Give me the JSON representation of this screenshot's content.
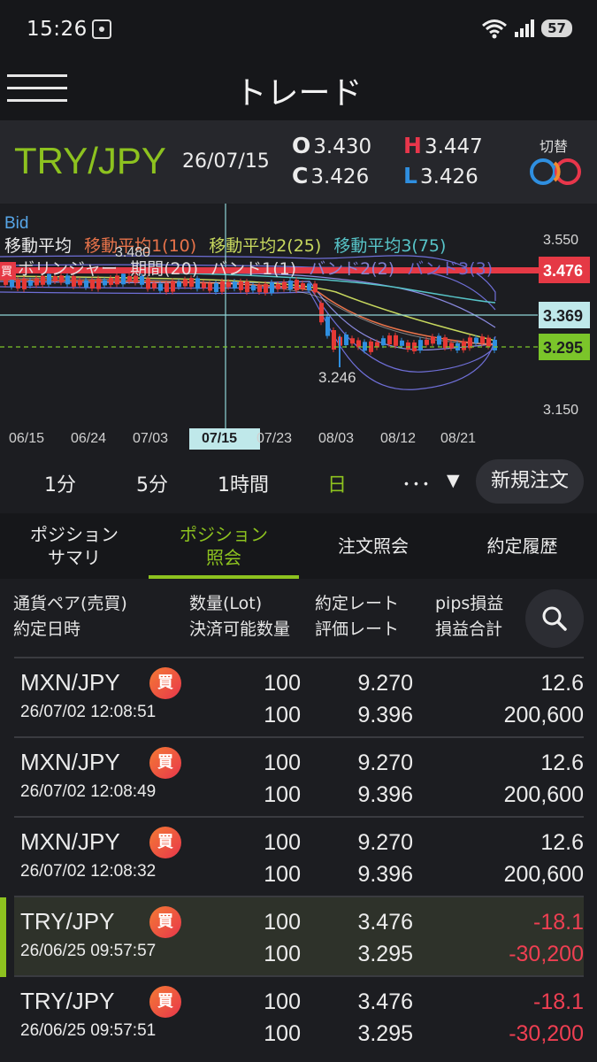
{
  "status": {
    "time": "15:26",
    "battery": "57",
    "wifi_badge": "6"
  },
  "header": {
    "title": "トレード",
    "menu_icon": "hamburger-icon"
  },
  "quote": {
    "pair": "TRY/JPY",
    "date": "26/07/15",
    "open_label": "O",
    "open": "3.430",
    "close_label": "C",
    "close": "3.426",
    "high_label": "H",
    "high": "3.447",
    "low_label": "L",
    "low": "3.426",
    "switch_label": "切替"
  },
  "chart": {
    "price_type": "Bid",
    "legend_line1": [
      "移動平均",
      "移動平均1(10)",
      "移動平均2(25)",
      "移動平均3(75)"
    ],
    "legend_line2": [
      "ボリンジャー",
      "期間(20)",
      "バンド1(1)",
      "バンド2(2)",
      "バンド3(3)"
    ],
    "buy_tag": "買",
    "axis_top": "3.550",
    "axis_bottom": "3.150",
    "order_rate": "3.476",
    "crosshair_rate": "3.369",
    "current_rate": "3.295",
    "peak_label": "3.480",
    "low_label": "3.246",
    "x_ticks": [
      "06/15",
      "06/24",
      "07/03",
      "07/15",
      "07/23",
      "08/03",
      "08/12",
      "08/21"
    ],
    "selected_date": "07/15",
    "colors": {
      "up": "#e53935",
      "down": "#2f8fe0",
      "ma1": "#e8734a",
      "ma2": "#c7d85e",
      "ma3": "#57c4c8",
      "band": "#6f6fd8"
    }
  },
  "timeframes": {
    "t1": "1分",
    "t2": "5分",
    "t3": "1時間",
    "t4": "日",
    "more": "･･･",
    "dropdown": "▼",
    "new_order": "新規注文"
  },
  "tabs": {
    "summary_line1": "ポジション",
    "summary_line2": "サマリ",
    "inquiry_line1": "ポジション",
    "inquiry_line2": "照会",
    "orders": "注文照会",
    "history": "約定履歴"
  },
  "columns": {
    "c1a": "通貨ペア(売買)",
    "c1b": "約定日時",
    "c2a": "数量(Lot)",
    "c2b": "決済可能数量",
    "c3a": "約定レート",
    "c3b": "評価レート",
    "c4a": "pips損益",
    "c4b": "損益合計"
  },
  "positions": [
    {
      "pair": "MXN/JPY",
      "side": "買",
      "datetime": "26/07/02 12:08:51",
      "qty": "100",
      "closable": "100",
      "rate": "9.270",
      "eval_rate": "9.396",
      "pips": "12.6",
      "pl": "200,600"
    },
    {
      "pair": "MXN/JPY",
      "side": "買",
      "datetime": "26/07/02 12:08:49",
      "qty": "100",
      "closable": "100",
      "rate": "9.270",
      "eval_rate": "9.396",
      "pips": "12.6",
      "pl": "200,600"
    },
    {
      "pair": "MXN/JPY",
      "side": "買",
      "datetime": "26/07/02 12:08:32",
      "qty": "100",
      "closable": "100",
      "rate": "9.270",
      "eval_rate": "9.396",
      "pips": "12.6",
      "pl": "200,600"
    },
    {
      "pair": "TRY/JPY",
      "side": "買",
      "datetime": "26/06/25 09:57:57",
      "qty": "100",
      "closable": "100",
      "rate": "3.476",
      "eval_rate": "3.295",
      "pips": "-18.1",
      "pl": "-30,200"
    },
    {
      "pair": "TRY/JPY",
      "side": "買",
      "datetime": "26/06/25 09:57:51",
      "qty": "100",
      "closable": "100",
      "rate": "3.476",
      "eval_rate": "3.295",
      "pips": "-18.1",
      "pl": "-30,200"
    }
  ]
}
